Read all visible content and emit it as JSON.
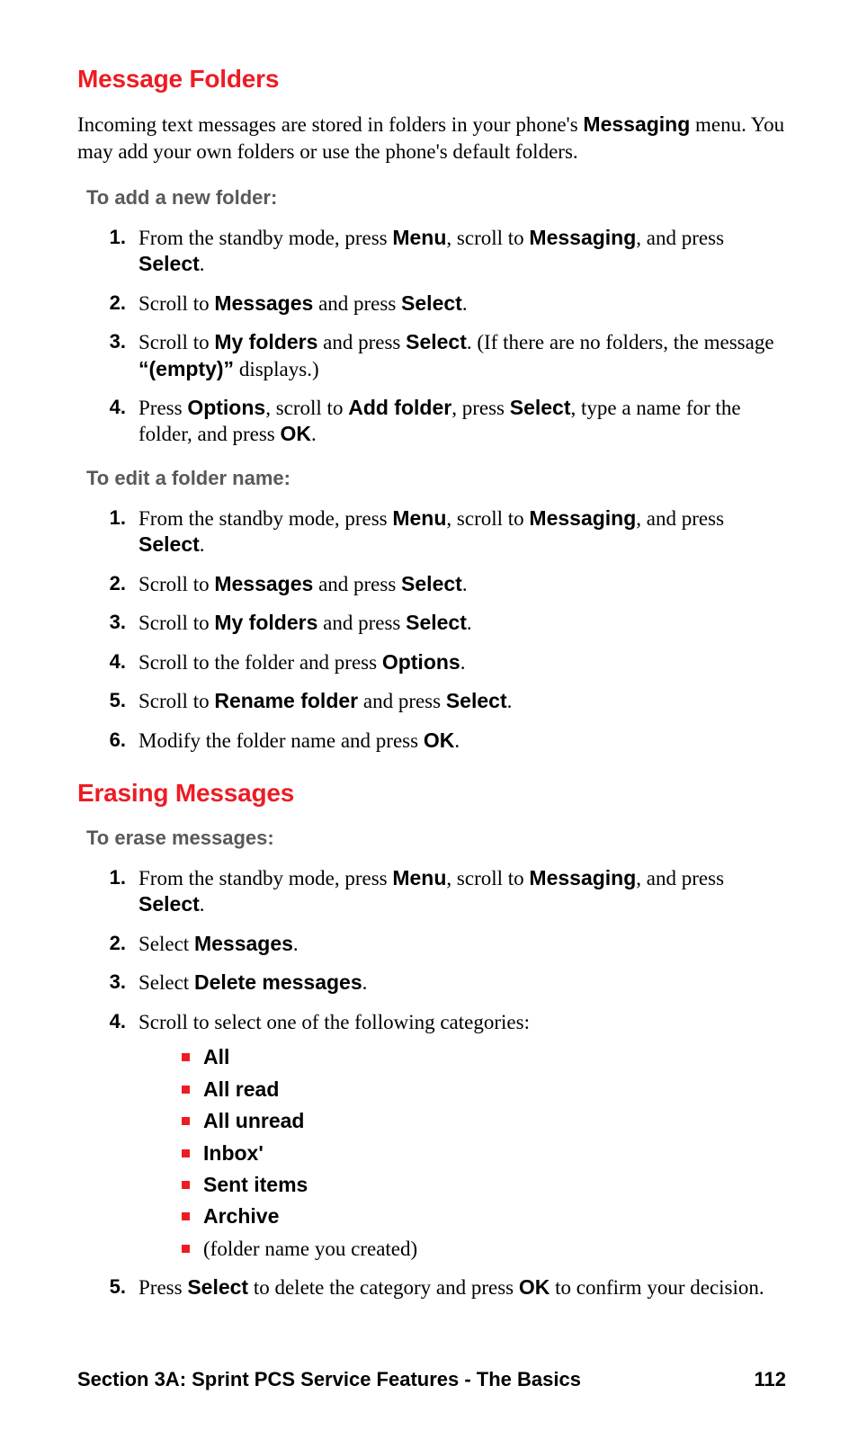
{
  "h1": "Message Folders",
  "intro_parts": {
    "a": "Incoming text messages are stored in folders in your phone's ",
    "b": "Messaging",
    "c": " menu. You may add your own folders or use the phone's default folders."
  },
  "sub_add": "To add a new folder:",
  "add_steps": [
    {
      "n": "1.",
      "a": "From the standby mode, press ",
      "b1": "Menu",
      "c": ", scroll to ",
      "b2": "Messaging",
      "d": ", and press ",
      "b3": "Select",
      "e": "."
    },
    {
      "n": "2.",
      "a": "Scroll to ",
      "b1": "Messages",
      "c": " and press ",
      "b2": "Select",
      "d": "."
    },
    {
      "n": "3.",
      "a": "Scroll to ",
      "b1": "My folders",
      "c": " and press ",
      "b2": "Select",
      "d": ". (If there are no folders, the message ",
      "b3": "“(empty)”",
      "e": " displays.)"
    },
    {
      "n": "4.",
      "a": "Press ",
      "b1": "Options",
      "c": ", scroll to ",
      "b2": "Add folder",
      "d": ", press ",
      "b3": "Select",
      "e": ", type a name for the folder, and press ",
      "b4": "OK",
      "f": "."
    }
  ],
  "sub_edit": "To edit a folder name:",
  "edit_steps": [
    {
      "n": "1.",
      "a": "From the standby mode, press ",
      "b1": "Menu",
      "c": ", scroll to ",
      "b2": "Messaging",
      "d": ", and press ",
      "b3": "Select",
      "e": "."
    },
    {
      "n": "2.",
      "a": "Scroll to ",
      "b1": "Messages",
      "c": " and press ",
      "b2": "Select",
      "d": "."
    },
    {
      "n": "3.",
      "a": "Scroll to ",
      "b1": "My folders",
      "c": " and press ",
      "b2": "Select",
      "d": "."
    },
    {
      "n": "4.",
      "a": "Scroll to the folder and press ",
      "b1": "Options",
      "c": "."
    },
    {
      "n": "5.",
      "a": "Scroll to ",
      "b1": "Rename folder",
      "c": " and press ",
      "b2": "Select",
      "d": "."
    },
    {
      "n": "6.",
      "a": "Modify the folder name and press ",
      "b1": "OK",
      "c": "."
    }
  ],
  "h2": "Erasing Messages",
  "sub_erase": "To erase messages:",
  "erase_steps": {
    "s1": {
      "n": "1.",
      "a": "From the standby mode, press ",
      "b1": "Menu",
      "c": ", scroll to ",
      "b2": "Messaging",
      "d": ", and press ",
      "b3": "Select",
      "e": "."
    },
    "s2": {
      "n": "2.",
      "a": "Select ",
      "b1": "Messages",
      "c": "."
    },
    "s3": {
      "n": "3.",
      "a": "Select ",
      "b1": "Delete messages",
      "c": "."
    },
    "s4": {
      "n": "4.",
      "a": "Scroll to select one of the following categories:"
    },
    "s5": {
      "n": "5.",
      "a": "Press ",
      "b1": "Select",
      "c": " to delete the category and press ",
      "b2": "OK",
      "d": " to confirm your decision."
    }
  },
  "categories": [
    "All",
    "All read",
    "All unread",
    "Inbox'",
    "Sent items",
    "Archive"
  ],
  "cat_extra": "(folder name you created)",
  "footer_left": "Section 3A: Sprint PCS Service Features - The Basics",
  "footer_right": "112"
}
